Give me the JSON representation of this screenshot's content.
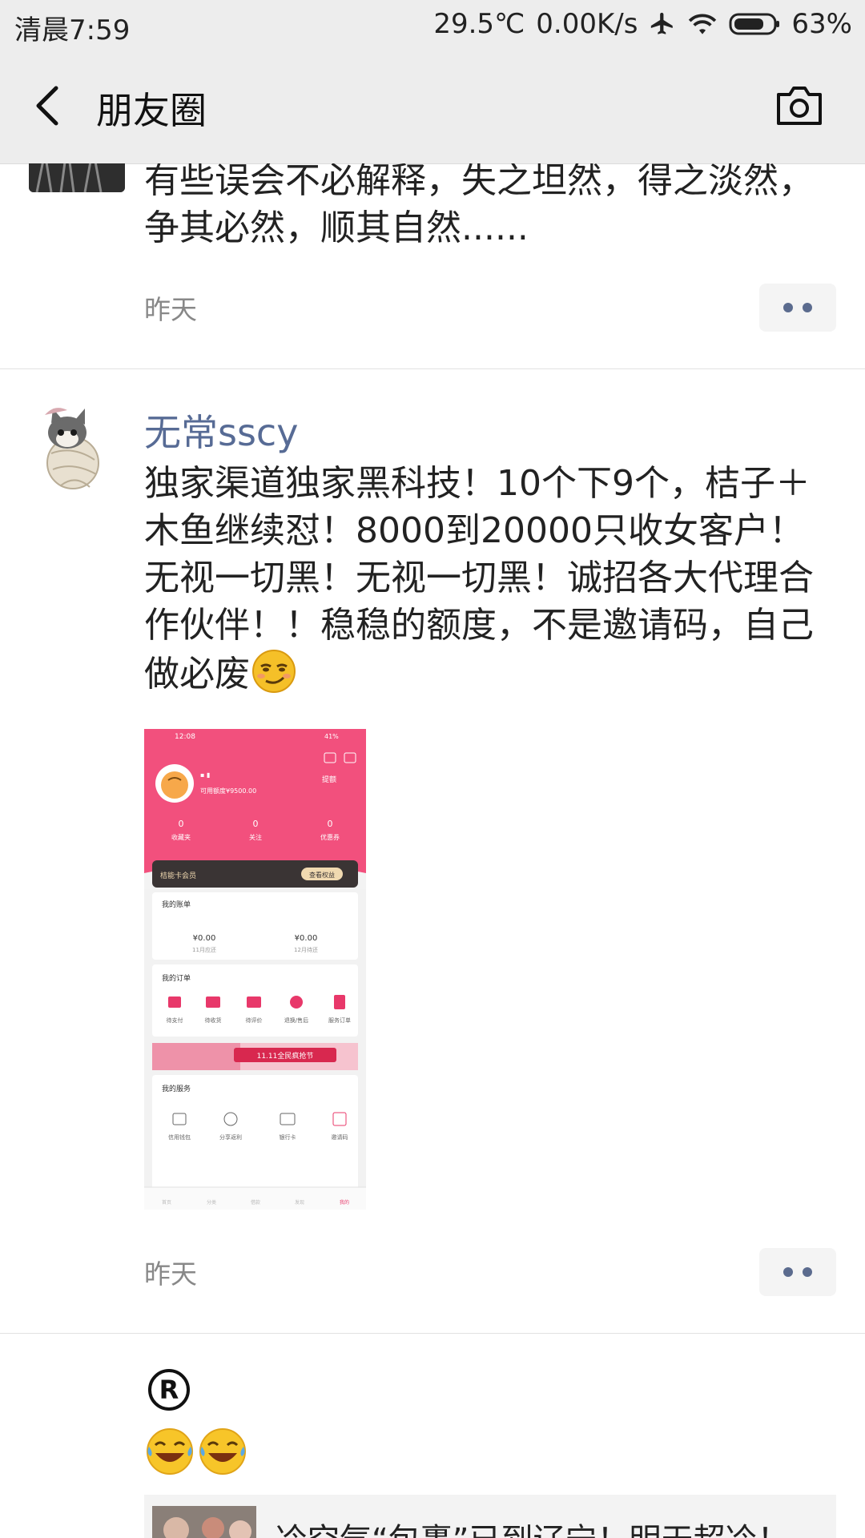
{
  "status_bar": {
    "time": "清晨7:59",
    "temperature": "29.5℃",
    "network_speed": "0.00K/s",
    "battery": "63%"
  },
  "nav": {
    "title": "朋友圈"
  },
  "posts": [
    {
      "text": "有些误会不必解释，失之坦然，得之淡然，争其必然，顺其自然......",
      "time": "昨天"
    },
    {
      "username": "无常sscy",
      "text": "独家渠道独家黑科技！10个下9个，桔子＋木鱼继续怼！8000到20000只收女客户！无视一切黑！无视一切黑！诚招各大代理合作伙伴！！稳稳的额度，不是邀请码，自己做必废",
      "time": "昨天",
      "image": {
        "status_time": "12:08",
        "status_battery": "41%",
        "limit": "可用额度¥9500.00",
        "withdraw": "提额",
        "stats": [
          {
            "value": "0",
            "label": "收藏夹"
          },
          {
            "value": "0",
            "label": "关注"
          },
          {
            "value": "0",
            "label": "优惠券"
          }
        ],
        "vip_label": "桔能卡会员",
        "vip_button": "查看权益",
        "bill_title": "我的账单",
        "bills": [
          {
            "value": "¥0.00",
            "label": "11月应还"
          },
          {
            "value": "¥0.00",
            "label": "12月待还"
          }
        ],
        "order_title": "我的订单",
        "orders": [
          "待支付",
          "待收货",
          "待评价",
          "退换/售后",
          "服务订单"
        ],
        "banner": "11.11全民疯抢节",
        "service_title": "我的服务",
        "services": [
          "信用钱包",
          "分享返利",
          "银行卡",
          "邀请码"
        ],
        "tabs": [
          "首页",
          "分类",
          "借款",
          "发现",
          "我的"
        ]
      }
    },
    {
      "link_text": "冷空气“包裹”已到辽宁！明天超冷！"
    }
  ]
}
